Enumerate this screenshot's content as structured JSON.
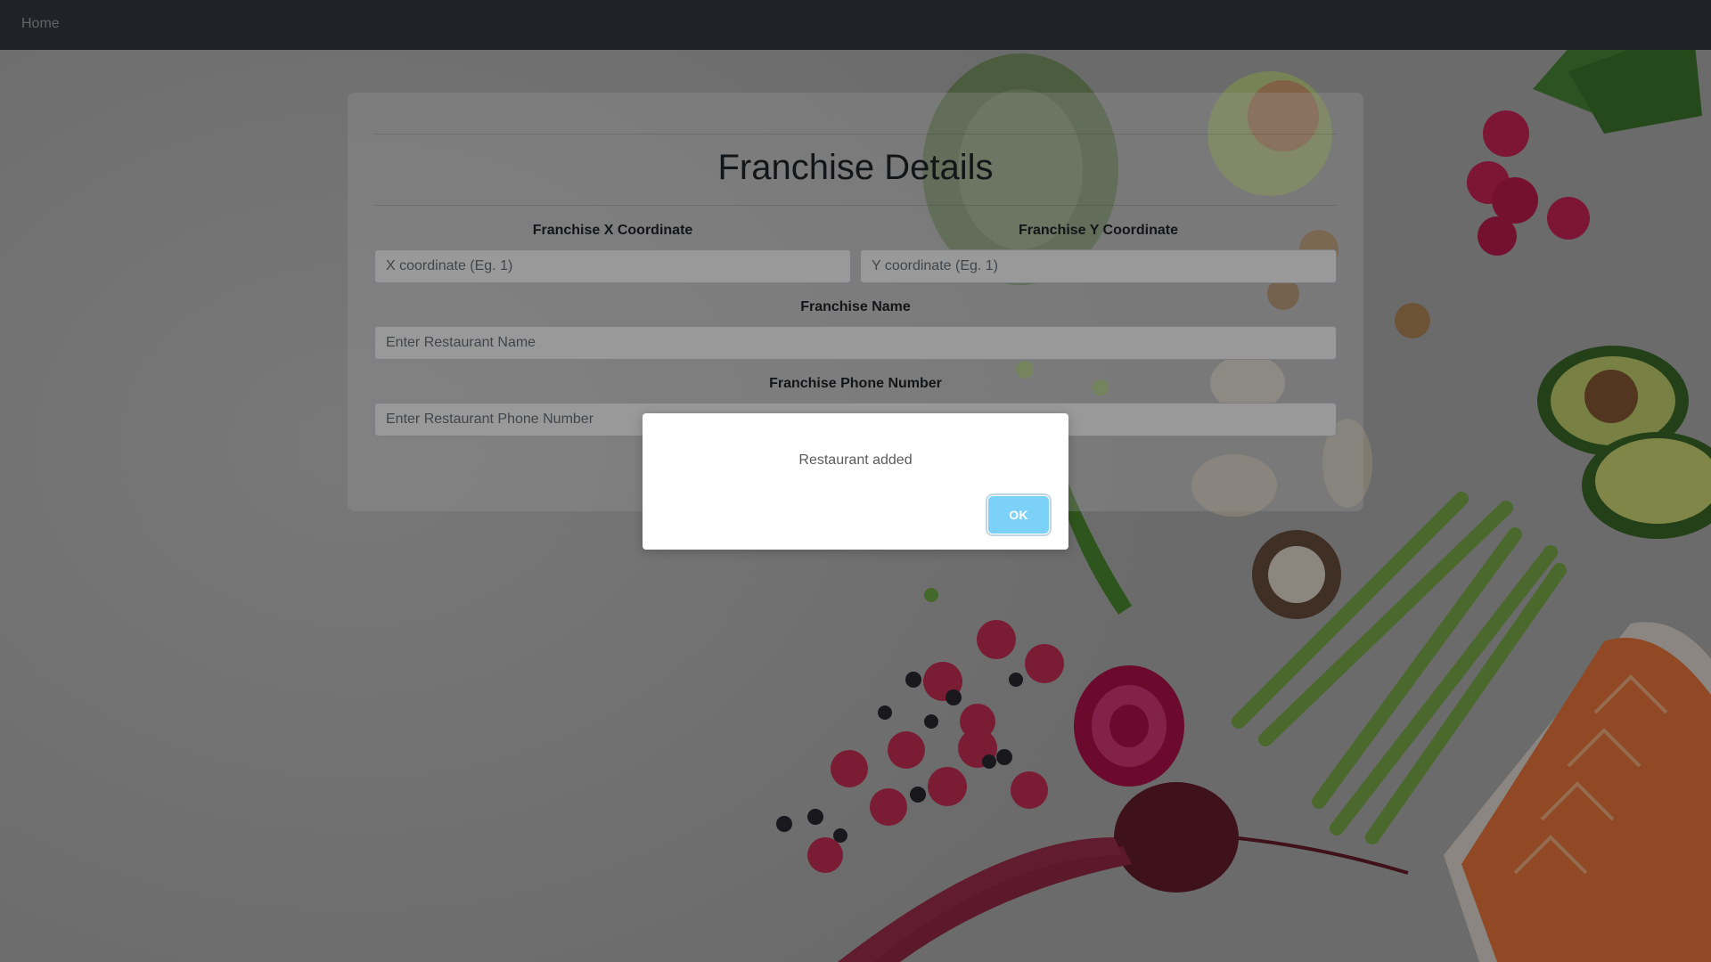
{
  "navbar": {
    "home_label": "Home"
  },
  "form": {
    "title": "Franchise Details",
    "x_coordinate": {
      "label": "Franchise X Coordinate",
      "placeholder": "X coordinate (Eg. 1)",
      "value": ""
    },
    "y_coordinate": {
      "label": "Franchise Y Coordinate",
      "placeholder": "Y coordinate (Eg. 1)",
      "value": ""
    },
    "name": {
      "label": "Franchise Name",
      "placeholder": "Enter Restaurant Name",
      "value": ""
    },
    "phone": {
      "label": "Franchise Phone Number",
      "placeholder": "Enter Restaurant Phone Number",
      "value": ""
    }
  },
  "alert": {
    "message": "Restaurant added",
    "ok_label": "OK"
  },
  "colors": {
    "navbar": "#343a40",
    "ok_button": "#7cd1f9",
    "overlay": "rgba(0,0,0,0.4)"
  }
}
